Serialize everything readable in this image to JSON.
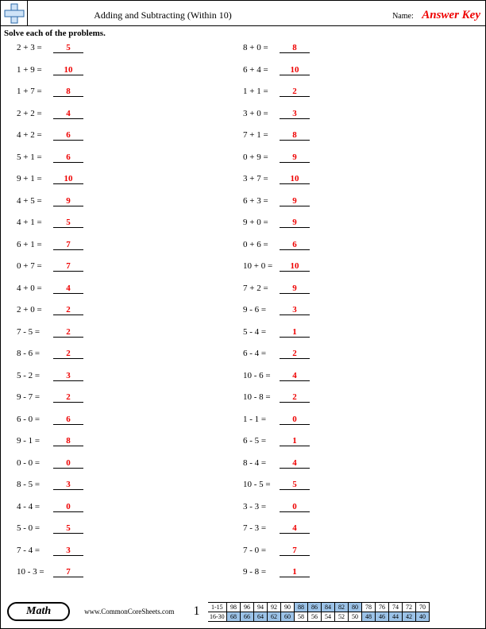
{
  "header": {
    "title": "Adding and Subtracting (Within 10)",
    "name_label": "Name:",
    "answer_key": "Answer Key"
  },
  "instructions": "Solve each of the problems.",
  "left": [
    {
      "expr": "2 + 3 =",
      "ans": "5"
    },
    {
      "expr": "1 + 9 =",
      "ans": "10"
    },
    {
      "expr": "1 + 7 =",
      "ans": "8"
    },
    {
      "expr": "2 + 2 =",
      "ans": "4"
    },
    {
      "expr": "4 + 2 =",
      "ans": "6"
    },
    {
      "expr": "5 + 1 =",
      "ans": "6"
    },
    {
      "expr": "9 + 1 =",
      "ans": "10"
    },
    {
      "expr": "4 + 5 =",
      "ans": "9"
    },
    {
      "expr": "4 + 1 =",
      "ans": "5"
    },
    {
      "expr": "6 + 1 =",
      "ans": "7"
    },
    {
      "expr": "0 + 7 =",
      "ans": "7"
    },
    {
      "expr": "4 + 0 =",
      "ans": "4"
    },
    {
      "expr": "2 + 0 =",
      "ans": "2"
    },
    {
      "expr": "7 - 5 =",
      "ans": "2"
    },
    {
      "expr": "8 - 6 =",
      "ans": "2"
    },
    {
      "expr": "5 - 2 =",
      "ans": "3"
    },
    {
      "expr": "9 - 7 =",
      "ans": "2"
    },
    {
      "expr": "6 - 0 =",
      "ans": "6"
    },
    {
      "expr": "9 - 1 =",
      "ans": "8"
    },
    {
      "expr": "0 - 0 =",
      "ans": "0"
    },
    {
      "expr": "8 - 5 =",
      "ans": "3"
    },
    {
      "expr": "4 - 4 =",
      "ans": "0"
    },
    {
      "expr": "5 - 0 =",
      "ans": "5"
    },
    {
      "expr": "7 - 4 =",
      "ans": "3"
    },
    {
      "expr": "10 - 3 =",
      "ans": "7"
    }
  ],
  "right": [
    {
      "expr": "8 + 0 =",
      "ans": "8"
    },
    {
      "expr": "6 + 4 =",
      "ans": "10"
    },
    {
      "expr": "1 + 1 =",
      "ans": "2"
    },
    {
      "expr": "3 + 0 =",
      "ans": "3"
    },
    {
      "expr": "7 + 1 =",
      "ans": "8"
    },
    {
      "expr": "0 + 9 =",
      "ans": "9"
    },
    {
      "expr": "3 + 7 =",
      "ans": "10"
    },
    {
      "expr": "6 + 3 =",
      "ans": "9"
    },
    {
      "expr": "9 + 0 =",
      "ans": "9"
    },
    {
      "expr": "0 + 6 =",
      "ans": "6"
    },
    {
      "expr": "10 + 0 =",
      "ans": "10"
    },
    {
      "expr": "7 + 2 =",
      "ans": "9"
    },
    {
      "expr": "9 - 6 =",
      "ans": "3"
    },
    {
      "expr": "5 - 4 =",
      "ans": "1"
    },
    {
      "expr": "6 - 4 =",
      "ans": "2"
    },
    {
      "expr": "10 - 6 =",
      "ans": "4"
    },
    {
      "expr": "10 - 8 =",
      "ans": "2"
    },
    {
      "expr": "1 - 1 =",
      "ans": "0"
    },
    {
      "expr": "6 - 5 =",
      "ans": "1"
    },
    {
      "expr": "8 - 4 =",
      "ans": "4"
    },
    {
      "expr": "10 - 5 =",
      "ans": "5"
    },
    {
      "expr": "3 - 3 =",
      "ans": "0"
    },
    {
      "expr": "7 - 3 =",
      "ans": "4"
    },
    {
      "expr": "7 - 0 =",
      "ans": "7"
    },
    {
      "expr": "9 - 8 =",
      "ans": "1"
    }
  ],
  "footer": {
    "subject": "Math",
    "site": "www.CommonCoreSheets.com",
    "page_number": "1",
    "rows": [
      {
        "label": "1-15",
        "cells": [
          "98",
          "96",
          "94",
          "92",
          "90",
          "88",
          "86",
          "84",
          "82",
          "80",
          "78",
          "76",
          "74",
          "72",
          "70"
        ],
        "shaded": [
          5,
          6,
          7,
          8,
          9
        ]
      },
      {
        "label": "16-30",
        "cells": [
          "68",
          "66",
          "64",
          "62",
          "60",
          "58",
          "56",
          "54",
          "52",
          "50",
          "48",
          "46",
          "44",
          "42",
          "40"
        ],
        "shaded": [
          0,
          1,
          2,
          3,
          4,
          10,
          11,
          12,
          13,
          14
        ]
      }
    ]
  }
}
